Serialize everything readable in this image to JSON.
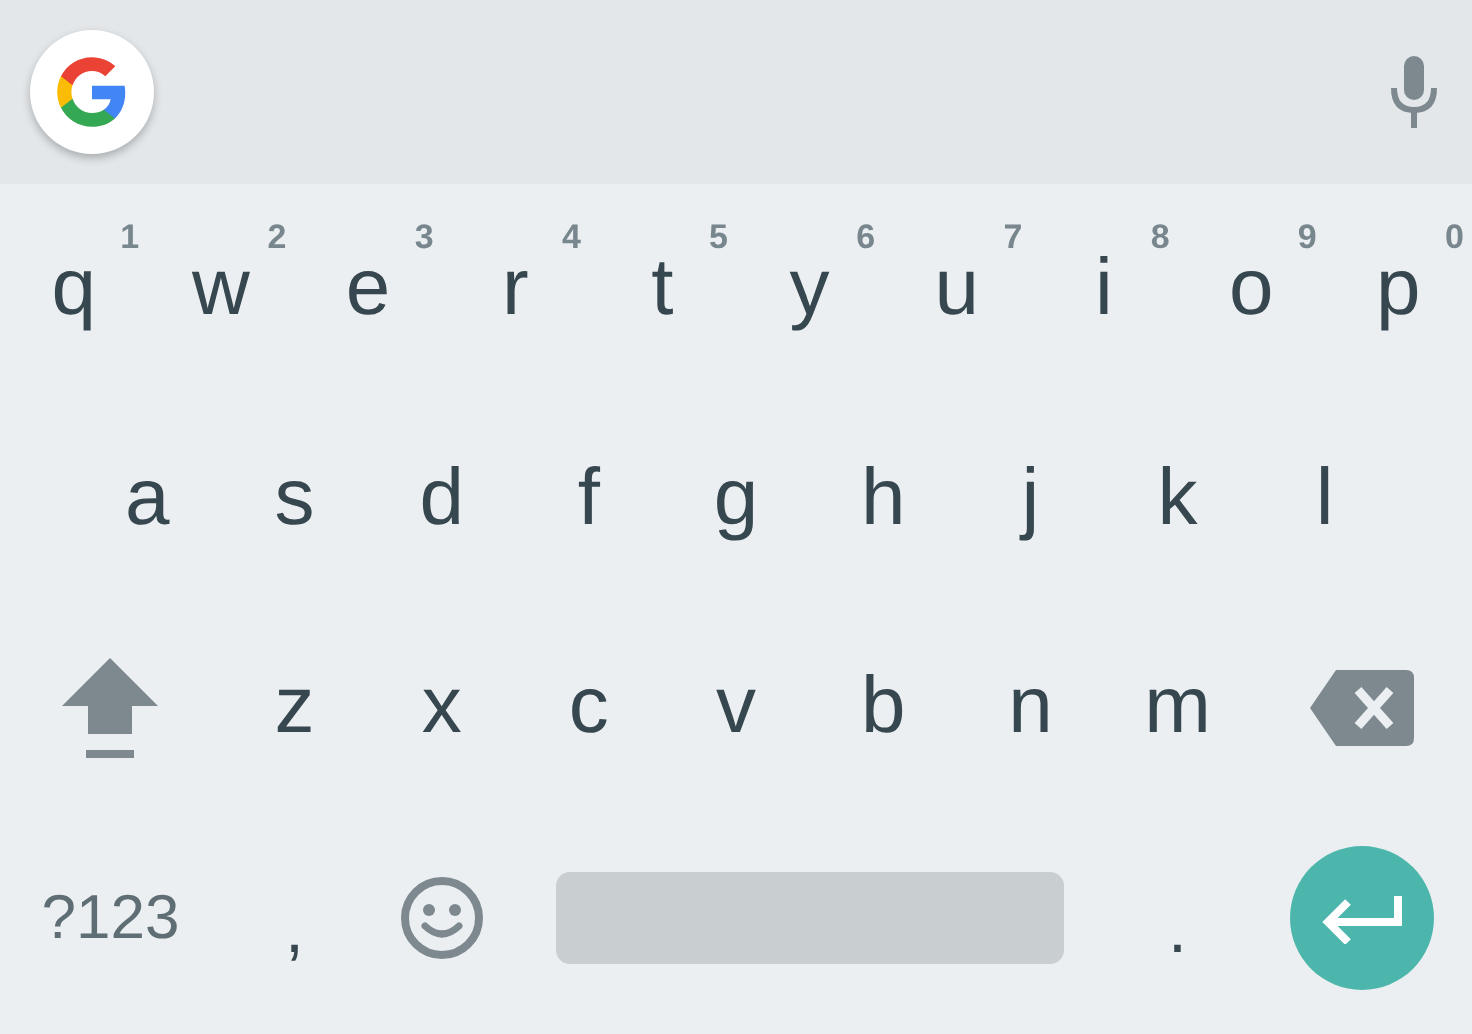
{
  "rows": [
    {
      "keys": [
        {
          "kind": "letter",
          "label": "q",
          "hint": "1"
        },
        {
          "kind": "letter",
          "label": "w",
          "hint": "2"
        },
        {
          "kind": "letter",
          "label": "e",
          "hint": "3"
        },
        {
          "kind": "letter",
          "label": "r",
          "hint": "4"
        },
        {
          "kind": "letter",
          "label": "t",
          "hint": "5"
        },
        {
          "kind": "letter",
          "label": "y",
          "hint": "6"
        },
        {
          "kind": "letter",
          "label": "u",
          "hint": "7"
        },
        {
          "kind": "letter",
          "label": "i",
          "hint": "8"
        },
        {
          "kind": "letter",
          "label": "o",
          "hint": "9"
        },
        {
          "kind": "letter",
          "label": "p",
          "hint": "0"
        }
      ]
    },
    {
      "keys": [
        {
          "kind": "letter",
          "label": "a"
        },
        {
          "kind": "letter",
          "label": "s"
        },
        {
          "kind": "letter",
          "label": "d"
        },
        {
          "kind": "letter",
          "label": "f"
        },
        {
          "kind": "letter",
          "label": "g"
        },
        {
          "kind": "letter",
          "label": "h"
        },
        {
          "kind": "letter",
          "label": "j"
        },
        {
          "kind": "letter",
          "label": "k"
        },
        {
          "kind": "letter",
          "label": "l"
        }
      ]
    },
    {
      "keys": [
        {
          "kind": "shift"
        },
        {
          "kind": "letter",
          "label": "z"
        },
        {
          "kind": "letter",
          "label": "x"
        },
        {
          "kind": "letter",
          "label": "c"
        },
        {
          "kind": "letter",
          "label": "v"
        },
        {
          "kind": "letter",
          "label": "b"
        },
        {
          "kind": "letter",
          "label": "n"
        },
        {
          "kind": "letter",
          "label": "m"
        },
        {
          "kind": "backspace"
        }
      ]
    },
    {
      "keys": [
        {
          "kind": "symbols",
          "label": "?123"
        },
        {
          "kind": "char",
          "label": ","
        },
        {
          "kind": "emoji"
        },
        {
          "kind": "space"
        },
        {
          "kind": "char",
          "label": "."
        },
        {
          "kind": "enter"
        }
      ]
    }
  ]
}
